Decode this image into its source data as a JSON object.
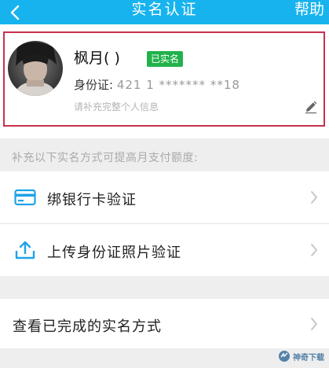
{
  "header": {
    "back_icon": "chevron-left-icon",
    "title": "实名认证",
    "help_label": "帮助",
    "background_color": "#17b3ee"
  },
  "profile": {
    "name": "枫月(  )",
    "verified_label": "已实名",
    "id_label": "身份证:",
    "id_number": "421  1  ******* **18",
    "complete_hint": "请补充完整个人信息",
    "edit_icon": "pencil-icon",
    "highlight_color": "#c8304a",
    "badge_color": "#22b24c"
  },
  "section_hint": "补充以下实名方式可提高月支付额度:",
  "methods": [
    {
      "label": "绑银行卡验证",
      "icon": "bank-card-icon"
    },
    {
      "label": "上传身份证照片验证",
      "icon": "upload-icon"
    }
  ],
  "completed": {
    "label": "查看已完成的实名方式"
  },
  "watermark": {
    "text": "神奇下载"
  }
}
